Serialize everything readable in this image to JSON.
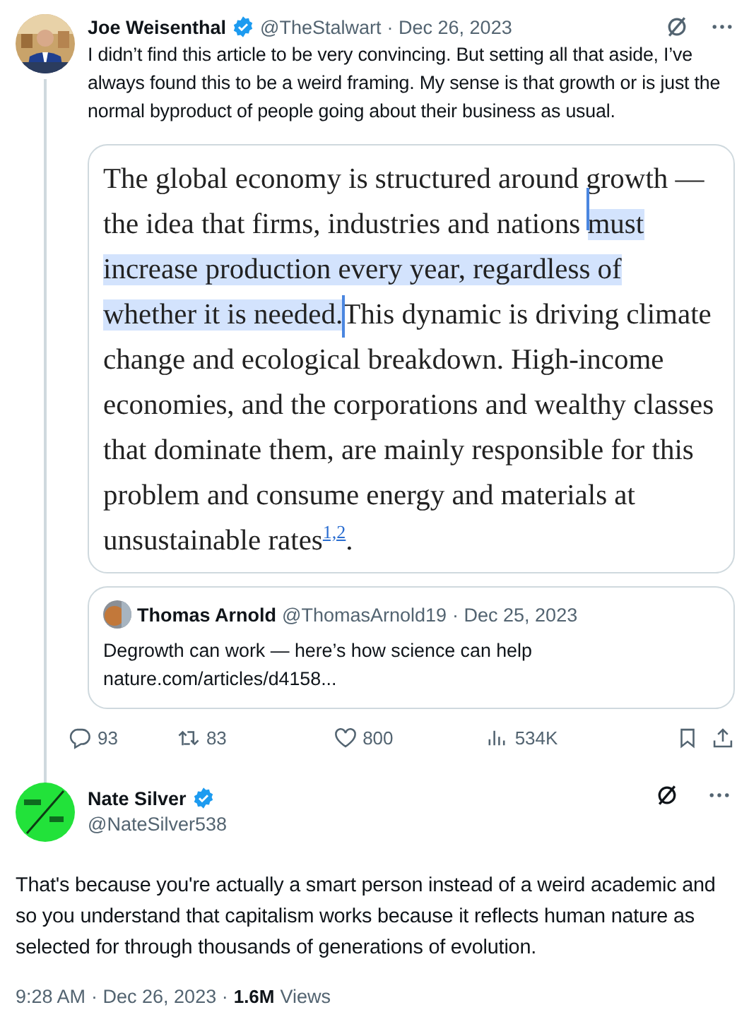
{
  "thread_tweet": {
    "name": "Joe Weisenthal",
    "verified": true,
    "handle": "@TheStalwart",
    "date": "· Dec 26, 2023",
    "text": "I didn’t find this article to be very convincing. But setting all that aside, I’ve always found this to be a weird framing. My sense is that growth or is just the normal byproduct of people going about their business as usual.",
    "image": {
      "segments": [
        {
          "text": "The global economy is structured around growth — the idea that firms, industries and nations ",
          "selected": false
        },
        {
          "text": "must increase production every year, regardless of whether it is needed.",
          "selected": true
        },
        {
          "text": "This dynamic is driving climate change and ecological breakdown. High-income economies, and the corporations and wealthy classes that dominate them, are mainly responsible for this problem and consume energy and materials at unsustainable rates",
          "selected": false
        }
      ],
      "footnote": "1,2",
      "end": "."
    },
    "quote": {
      "name": "Thomas Arnold",
      "handle": "@ThomasArnold19",
      "date": "· Dec 25, 2023",
      "text": "Degrowth can work — here’s how science can help",
      "link": "nature.com/articles/d4158..."
    },
    "stats": [
      {
        "kind": "reply",
        "count": "93"
      },
      {
        "kind": "retweet",
        "count": "83"
      },
      {
        "kind": "like",
        "count": "800"
      },
      {
        "kind": "views",
        "count": "534K"
      },
      {
        "kind": "bookmark"
      },
      {
        "kind": "share"
      }
    ]
  },
  "main_tweet": {
    "name": "Nate Silver",
    "verified": true,
    "handle": "@NateSilver538",
    "text": "That's because you're actually a smart person instead of a weird academic and so you understand that capitalism works because it reflects human nature as selected for through thousands of generations of evolution.",
    "time": "9:28 AM",
    "date": "· Dec 26, 2023 ·",
    "views_count": "1.6M",
    "views_label": "Views"
  }
}
